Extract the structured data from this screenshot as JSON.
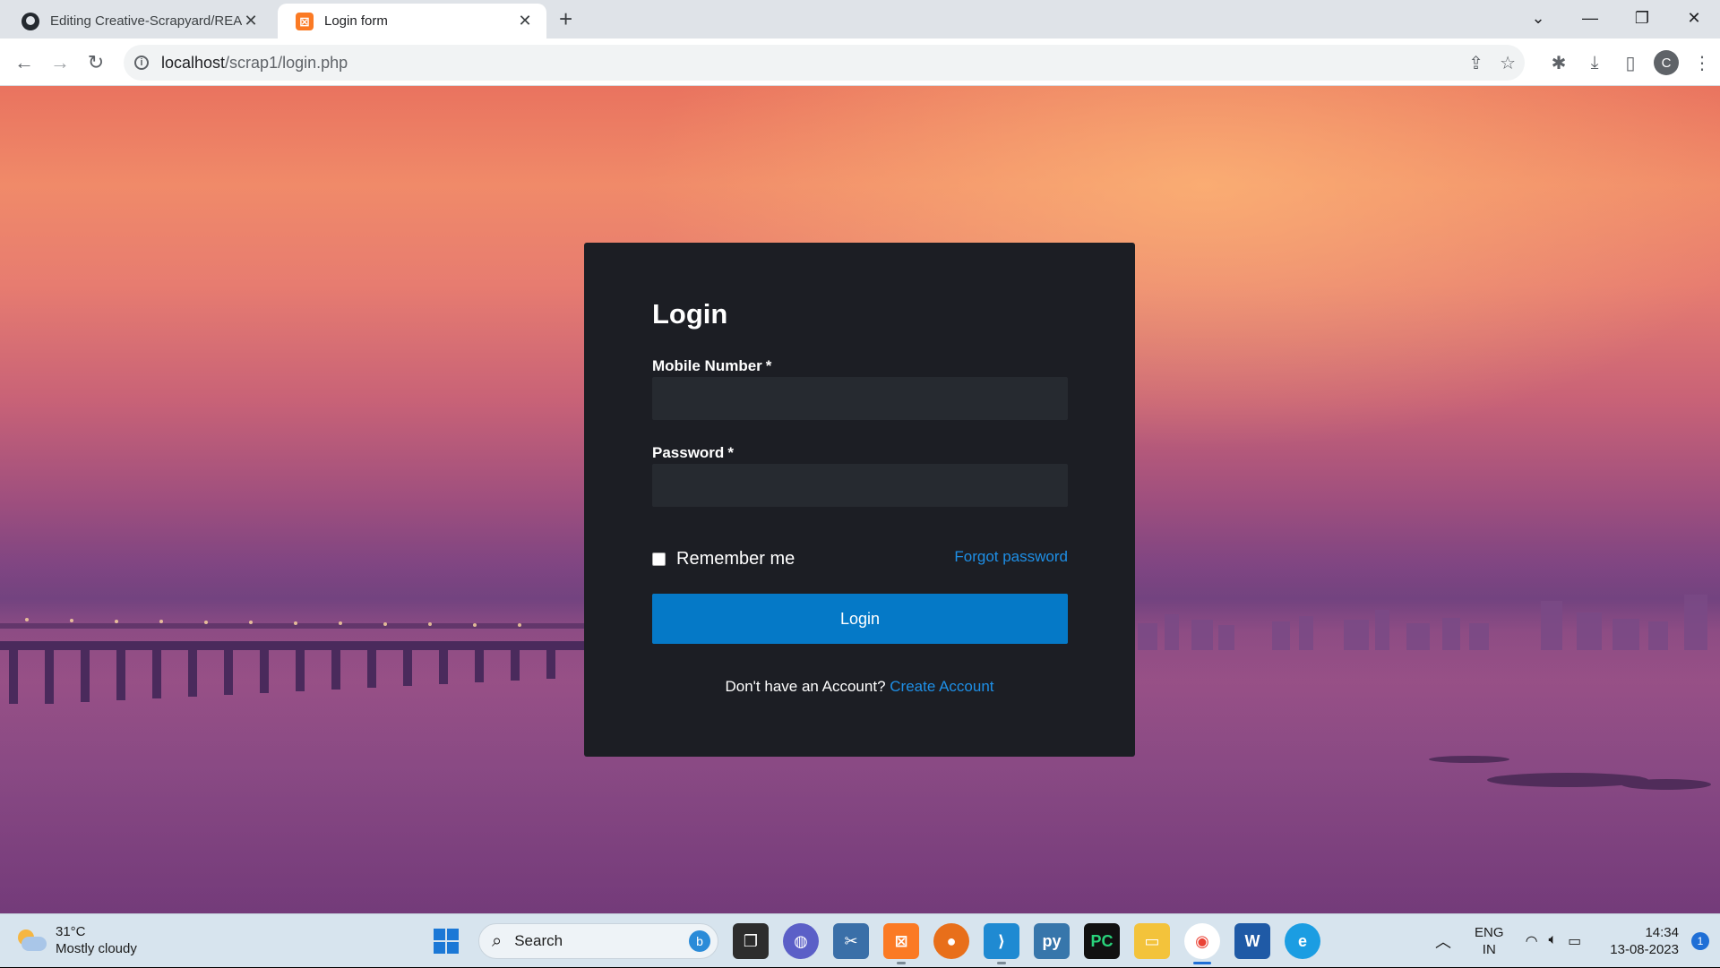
{
  "browser": {
    "tabs": [
      {
        "title": "Editing Creative-Scrapyard/READ",
        "active": false
      },
      {
        "title": "Login form",
        "active": true
      }
    ],
    "url_host": "localhost",
    "url_path": "/scrap1/login.php"
  },
  "form": {
    "title": "Login",
    "mobile_label": "Mobile Number",
    "password_label": "Password",
    "required_marker": "*",
    "remember_label": "Remember me",
    "forgot_label": "Forgot password",
    "login_button": "Login",
    "signup_prompt": "Don't have an Account?",
    "signup_link": "Create Account"
  },
  "taskbar": {
    "weather_temp": "31°C",
    "weather_condition": "Mostly cloudy",
    "search_label": "Search",
    "lang_primary": "ENG",
    "lang_region": "IN",
    "time": "14:34",
    "date": "13-08-2023",
    "notification_count": "1"
  },
  "colors": {
    "card_background": "#1c1e24",
    "input_background": "#262a30",
    "primary_button": "#0579c7",
    "link": "#1e8fe6"
  }
}
